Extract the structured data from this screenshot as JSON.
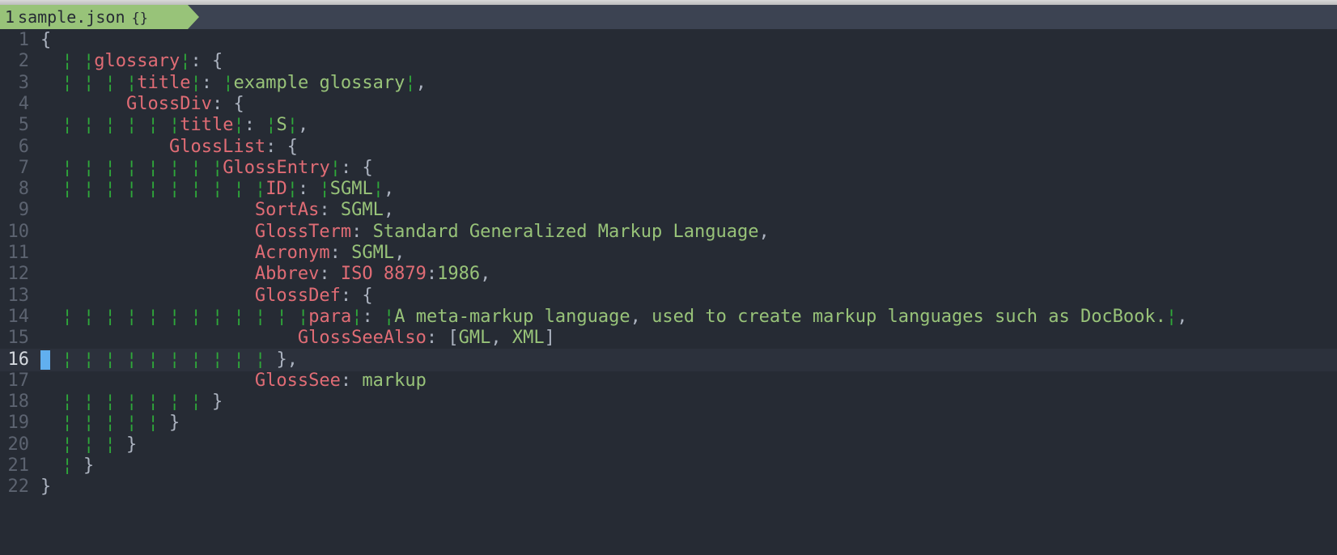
{
  "tab": {
    "number": "1",
    "filename": "sample.json",
    "icon": "{}"
  },
  "editor": {
    "current_line": 16,
    "lines": [
      {
        "n": "1",
        "code": "{"
      },
      {
        "n": "2",
        "code": "  ¦ ¦glossary¦: {"
      },
      {
        "n": "3",
        "code": "  ¦ ¦ ¦ ¦title¦: ¦example glossary¦,"
      },
      {
        "n": "4",
        "code": "        GlossDiv: {"
      },
      {
        "n": "5",
        "code": "  ¦ ¦ ¦ ¦ ¦ ¦title¦: ¦S¦,"
      },
      {
        "n": "6",
        "code": "            GlossList: {"
      },
      {
        "n": "7",
        "code": "  ¦ ¦ ¦ ¦ ¦ ¦ ¦ ¦GlossEntry¦: {"
      },
      {
        "n": "8",
        "code": "  ¦ ¦ ¦ ¦ ¦ ¦ ¦ ¦ ¦ ¦ID¦: ¦SGML¦,"
      },
      {
        "n": "9",
        "code": "                    SortAs: SGML,"
      },
      {
        "n": "10",
        "code": "                    GlossTerm: Standard Generalized Markup Language,"
      },
      {
        "n": "11",
        "code": "                    Acronym: SGML,"
      },
      {
        "n": "12",
        "code": "                    Abbrev: ISO 8879:1986,"
      },
      {
        "n": "13",
        "code": "                    GlossDef: {"
      },
      {
        "n": "14",
        "code": "  ¦ ¦ ¦ ¦ ¦ ¦ ¦ ¦ ¦ ¦ ¦ ¦para¦: ¦A meta-markup language, used to create markup languages such as DocBook.¦,"
      },
      {
        "n": "15",
        "code": "                        GlossSeeAlso: [GML, XML]"
      },
      {
        "n": "16",
        "code": "  ¦ ¦ ¦ ¦ ¦ ¦ ¦ ¦ ¦ ¦ },"
      },
      {
        "n": "17",
        "code": "                    GlossSee: markup"
      },
      {
        "n": "18",
        "code": "  ¦ ¦ ¦ ¦ ¦ ¦ ¦ }"
      },
      {
        "n": "19",
        "code": "  ¦ ¦ ¦ ¦ ¦ }"
      },
      {
        "n": "20",
        "code": "  ¦ ¦ ¦ }"
      },
      {
        "n": "21",
        "code": "  ¦ }"
      },
      {
        "n": "22",
        "code": "}"
      }
    ]
  },
  "colors": {
    "background": "#262b34",
    "current_line": "#2c313c",
    "line_number": "#5c6370",
    "indent_guide": "#2fa83a",
    "key": "#e06c75",
    "string": "#98c379",
    "punctuation": "#abb2bf",
    "cursor": "#61afef",
    "tab_bg": "#98c379",
    "tabline_bg": "#3c4352"
  }
}
